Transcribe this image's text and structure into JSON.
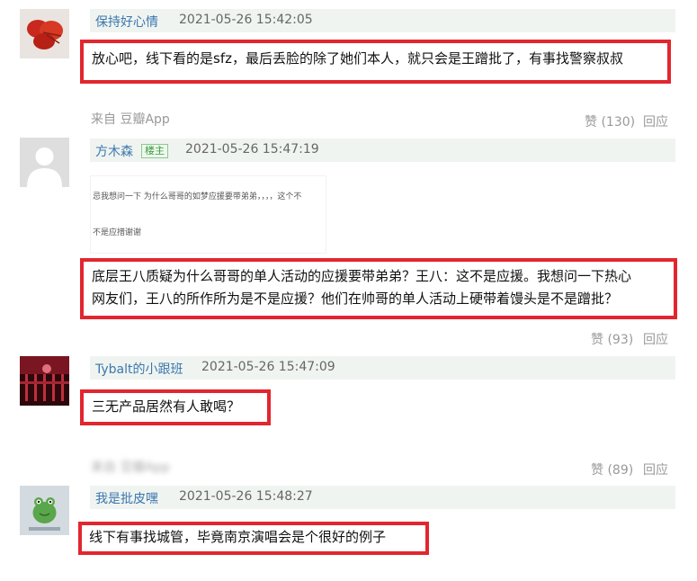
{
  "comments": [
    {
      "username": "保持好心情",
      "time": "2021-05-26 15:42:05",
      "text": "放心吧，线下看的是sfz，最后丢脸的除了她们本人，就只会是王蹭批了，有事找警察叔叔",
      "source": "来自 豆瓣App",
      "likes": "赞 (130)",
      "reply": "回应"
    },
    {
      "username": "方木森",
      "badge": "楼主",
      "time": "2021-05-26 15:47:19",
      "embed_lines": [
        "忌我想问一下 为什么哥哥的如梦应援要带弟弟，，，，这个不",
        "不是应措谢谢"
      ],
      "text_lines": [
        "底层王八质疑为什么哥哥的单人活动的应援要带弟弟？王八：这不是应援。我想问一下热心",
        "网友们，王八的所作所为是不是应援？他们在帅哥的单人活动上硬带着馒头是不是蹭批？"
      ],
      "likes": "赞 (93)",
      "reply": "回应"
    },
    {
      "username": "Tybalt的小跟班",
      "time": "2021-05-26 15:47:09",
      "text": "三无产品居然有人敢喝？",
      "source": "来自 豆瓣App",
      "likes": "赞 (89)",
      "reply": "回应"
    },
    {
      "username": "我是批皮嘿",
      "time": "2021-05-26 15:48:27",
      "text": "线下有事找城管，毕竟南京演唱会是个很好的例子"
    }
  ]
}
